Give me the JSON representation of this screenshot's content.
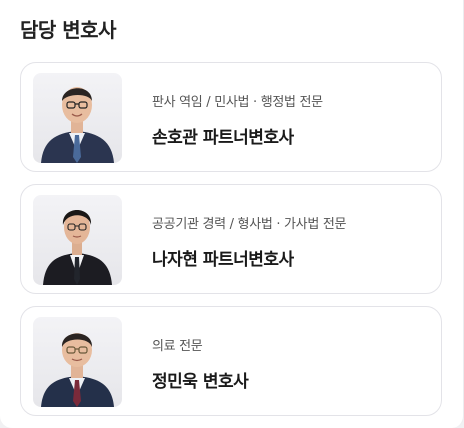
{
  "section": {
    "title": "담당 변호사"
  },
  "lawyers": [
    {
      "subtitle": "판사 역임 / 민사법 · 행정법 전문",
      "name": "손호관 파트너변호사",
      "suit_color": "#2b3550",
      "tie_color": "#4a6a9a"
    },
    {
      "subtitle": "공공기관 경력 / 형사법 · 가사법 전문",
      "name": "나자현 파트너변호사",
      "suit_color": "#1c1c22",
      "tie_color": "#22252c"
    },
    {
      "subtitle": "의료 전문",
      "name": "정민욱 변호사",
      "suit_color": "#24304a",
      "tie_color": "#7a2a3a"
    }
  ]
}
